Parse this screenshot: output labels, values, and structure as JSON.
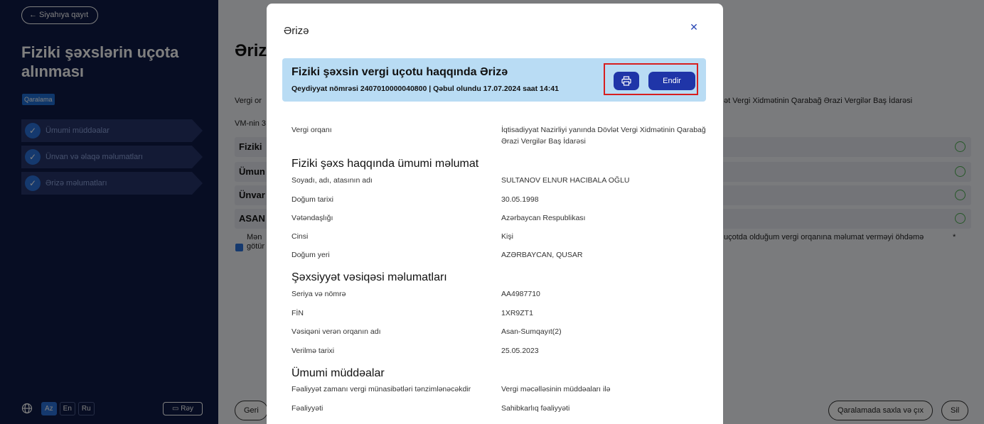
{
  "background": {
    "back_label": "← Siyahıya qayıt",
    "sidebar_title": "Fiziki şəxslərin uçota alınması",
    "draft_badge": "Qaralama",
    "steps": [
      {
        "label": "Ümumi müddəalar"
      },
      {
        "label": "Ünvan və əlaqə məlumatları"
      },
      {
        "label": "Ərizə məlumatları"
      }
    ],
    "languages": [
      "Az",
      "En",
      "Ru"
    ],
    "active_language": "Az",
    "ray_label": "Rəy",
    "main_title": "Əriz",
    "vergi_prefix": "Vergi or",
    "vergi_right": "ət Vergi Xidmətinin Qarabağ Ərazi Vergilər Baş İdarəsi",
    "vm_prefix": "VM-nin 3",
    "rows": [
      {
        "label": "Fiziki"
      },
      {
        "label": "Ümun"
      },
      {
        "label": "Ünvar"
      },
      {
        "label": "ASAN"
      }
    ],
    "consent_left_1": "Mən",
    "consent_left_2": "götür",
    "consent_right": "uçotda olduğum vergi orqanına məlumat verməyi öhdəmə",
    "asterisk": "*",
    "back_button": "Geri",
    "save_draft_button": "Qaralamada saxla və çıx",
    "delete_button": "Sil"
  },
  "modal": {
    "title": "Ərizə",
    "close_icon": "close-icon",
    "header": {
      "title": "Fiziki şəxsin vergi uçotu haqqında Ərizə",
      "subtitle": "Qeydiyyat nömrəsi 2407010000040800 | Qəbul olundu 17.07.2024 saat 14:41",
      "print_icon": "printer-icon",
      "download_label": "Endir"
    },
    "tax_authority": {
      "label": "Vergi orqanı",
      "value": "İqtisadiyyat Nazirliyi yanında Dövlət Vergi Xidmətinin Qarabağ Ərazi Vergilər Baş İdarəsi"
    },
    "person_section": {
      "title": "Fiziki şəxs haqqında ümumi məlumat",
      "fields": [
        {
          "label": "Soyadı, adı, atasının adı",
          "value": "SULTANOV ELNUR HACIBALA OĞLU"
        },
        {
          "label": "Doğum tarixi",
          "value": "30.05.1998"
        },
        {
          "label": "Vətəndaşlığı",
          "value": "Azərbaycan Respublikası"
        },
        {
          "label": "Cinsi",
          "value": "Kişi"
        },
        {
          "label": "Doğum yeri",
          "value": "AZƏRBAYCAN, QUSAR"
        }
      ]
    },
    "id_section": {
      "title": "Şəxsiyyət vəsiqəsi məlumatları",
      "fields": [
        {
          "label": "Seriya və nömrə",
          "value": "AA4987710"
        },
        {
          "label": "FİN",
          "value": "1XR9ZT1"
        },
        {
          "label": "Vəsiqəni verən orqanın adı",
          "value": "Asan-Sumqayıt(2)"
        },
        {
          "label": "Verilmə tarixi",
          "value": "25.05.2023"
        }
      ]
    },
    "general_section": {
      "title": "Ümumi müddəalar",
      "fields": [
        {
          "label": "Fəaliyyət zamanı vergi münasibətləri tənzimlənəcəkdir",
          "value": "Vergi məcəlləsinin müddəaları ilə"
        },
        {
          "label": "Fəaliyyəti",
          "value": "Sahibkarlıq fəaliyyəti"
        }
      ]
    }
  }
}
